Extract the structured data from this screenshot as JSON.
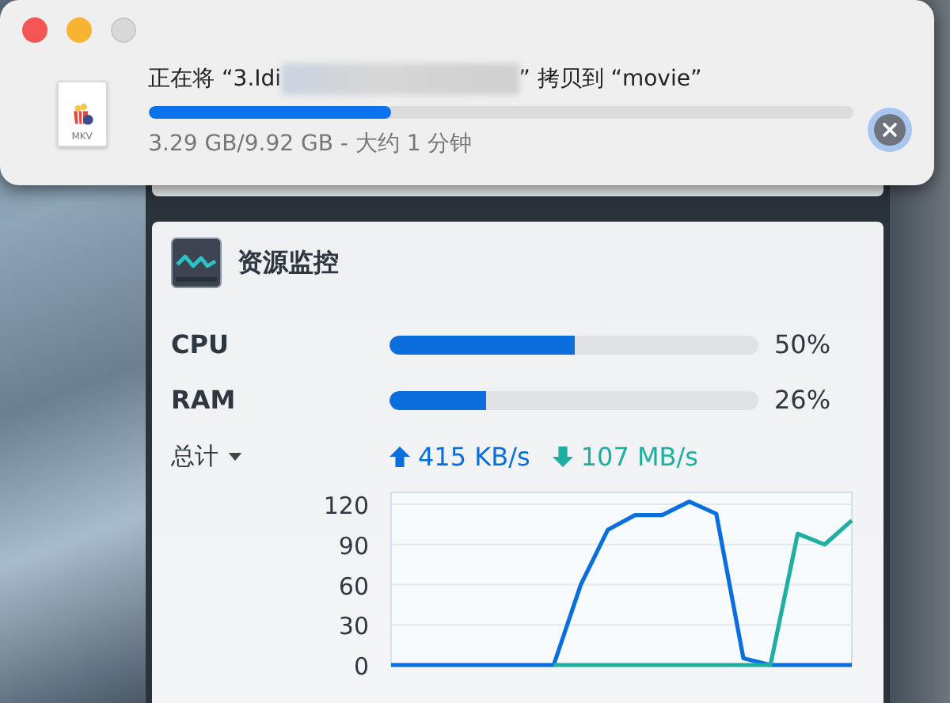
{
  "copy_dialog": {
    "file_icon_label": "MKV",
    "title_prefix": "正在将 “3.Idi",
    "title_suffix": "” 拷贝到 “movie”",
    "level": 0.345,
    "status": "3.29 GB/9.92 GB - 大约 1 分钟"
  },
  "resource_monitor": {
    "title": "资源监控",
    "meters": [
      {
        "label": "CPU",
        "level": 0.5,
        "reading": "50%"
      },
      {
        "label": "RAM",
        "level": 0.26,
        "reading": "26%"
      }
    ],
    "network": {
      "label": "总计",
      "upload": "415 KB/s",
      "download": "107 MB/s"
    },
    "chart_data": {
      "type": "line",
      "grid": true,
      "ylim": [
        0,
        123
      ],
      "yticks": [
        0,
        30,
        60,
        90,
        120
      ],
      "series": [
        {
          "color": "#0a6fdc",
          "values": [
            0,
            0,
            0,
            0,
            0,
            0,
            0,
            60,
            101,
            112,
            112,
            122,
            113,
            5,
            0,
            0,
            0,
            0
          ]
        },
        {
          "color": "#1faea0",
          "values": [
            null,
            null,
            null,
            null,
            null,
            null,
            0,
            0,
            0,
            0,
            0,
            0,
            0,
            0,
            0,
            98,
            90,
            108
          ]
        }
      ]
    }
  }
}
